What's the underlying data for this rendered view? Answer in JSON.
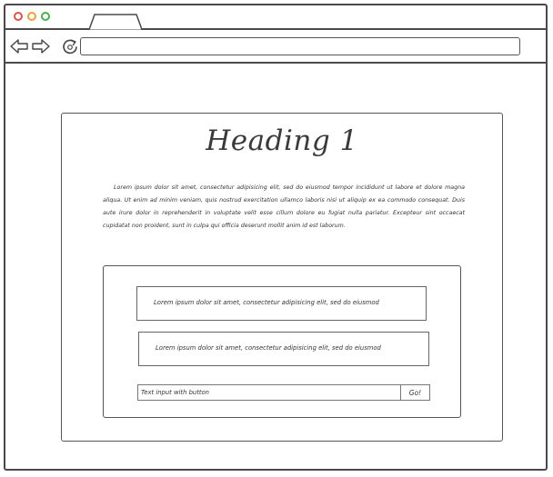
{
  "browser": {
    "address_value": "",
    "colors": {
      "close": "#d9534f",
      "minimize": "#e8a23a",
      "maximize": "#4caf50",
      "frame": "#4a4a4a"
    },
    "icons": {
      "back": "back-arrow-icon",
      "forward": "forward-arrow-icon",
      "reload": "reload-icon"
    }
  },
  "content": {
    "heading": "Heading 1",
    "paragraph": "Lorem ipsum dolor sit amet, consectetur adipisicing elit, sed do eiusmod tempor incididunt ut labore et dolore magna aliqua. Ut enim ad minim veniam, quis nostrud exercitation ullamco laboris nisi ut aliquip ex ea commodo consequat. Duis aute irure dolor in reprehenderit in voluptate velit esse cillum dolore eu fugiat nulla pariatur. Excepteur sint occaecat cupidatat non proident, sunt in culpa qui officia deserunt mollit anim id est laborum.",
    "panel": {
      "box1_text": "Lorem ipsum dolor sit amet, consectetur adipisicing elit, sed do eiusmod",
      "box2_text": "Lorem ipsum dolor sit amet, consectetur adipisicing elit, sed do eiusmod",
      "input_value": "Text input with button",
      "button_label": "Go!"
    }
  }
}
